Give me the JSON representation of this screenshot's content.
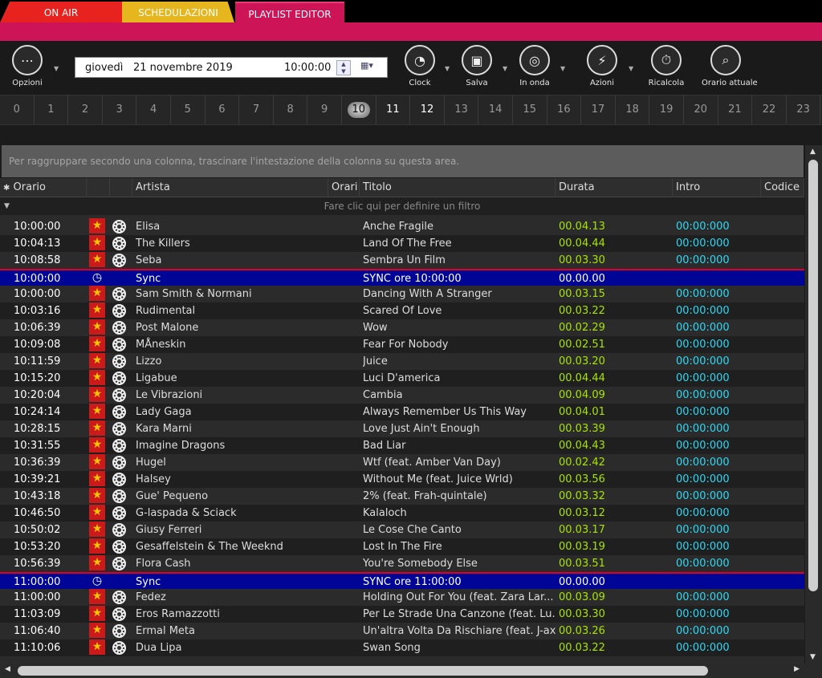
{
  "tabs": [
    {
      "label": "ON AIR"
    },
    {
      "label": "SCHEDULAZIONI"
    },
    {
      "label": "PLAYLIST EDITOR"
    }
  ],
  "toolbar": {
    "options_label": "Opzioni",
    "date": {
      "day": "giovedì",
      "date": "21 novembre 2019",
      "time": "10:00:00"
    },
    "clock_label": "Clock",
    "save_label": "Salva",
    "onair_label": "In onda",
    "actions_label": "Azioni",
    "recalc_label": "Ricalcola",
    "current_time_label": "Orario attuale"
  },
  "hours": [
    "0",
    "1",
    "2",
    "3",
    "4",
    "5",
    "6",
    "7",
    "8",
    "9",
    "10",
    "11",
    "12",
    "13",
    "14",
    "15",
    "16",
    "17",
    "18",
    "19",
    "20",
    "21",
    "22",
    "23"
  ],
  "group_panel_text": "Per raggruppare secondo una colonna, trascinare l'intestazione della colonna su questa area.",
  "columns": {
    "orario": "Orario",
    "artista": "Artista",
    "orari": "Orari",
    "titolo": "Titolo",
    "durata": "Durata",
    "intro": "Intro",
    "codice": "Codice"
  },
  "filter_text": "Fare clic qui per definire un filtro",
  "rows": [
    {
      "time": "10:00:00",
      "artist": "Elisa",
      "title": "Anche Fragile",
      "dur": "00.04.13",
      "intro": "00:00:000"
    },
    {
      "time": "10:04:13",
      "artist": "The Killers",
      "title": "Land Of The Free",
      "dur": "00.04.44",
      "intro": "00:00:000"
    },
    {
      "time": "10:08:58",
      "artist": "Seba",
      "title": "Sembra Un Film",
      "dur": "00.03.30",
      "intro": "00:00:000"
    },
    {
      "time": "10:00:00",
      "artist": "Sync",
      "title": "SYNC ore 10:00:00",
      "dur": "00.00.00",
      "intro": "",
      "sync": true
    },
    {
      "time": "10:00:00",
      "artist": "Sam Smith & Normani",
      "title": "Dancing With A Stranger",
      "dur": "00.03.15",
      "intro": "00:00:000"
    },
    {
      "time": "10:03:16",
      "artist": "Rudimental",
      "title": "Scared Of Love",
      "dur": "00.03.22",
      "intro": "00:00:000"
    },
    {
      "time": "10:06:39",
      "artist": "Post Malone",
      "title": "Wow",
      "dur": "00.02.29",
      "intro": "00:00:000"
    },
    {
      "time": "10:09:08",
      "artist": "MÅneskin",
      "title": "Fear For Nobody",
      "dur": "00.02.51",
      "intro": "00:00:000"
    },
    {
      "time": "10:11:59",
      "artist": "Lizzo",
      "title": "Juice",
      "dur": "00.03.20",
      "intro": "00:00:000"
    },
    {
      "time": "10:15:20",
      "artist": "Ligabue",
      "title": "Luci D'america",
      "dur": "00.04.44",
      "intro": "00:00:000"
    },
    {
      "time": "10:20:04",
      "artist": "Le Vibrazioni",
      "title": "Cambia",
      "dur": "00.04.09",
      "intro": "00:00:000"
    },
    {
      "time": "10:24:14",
      "artist": "Lady Gaga",
      "title": "Always Remember Us This Way",
      "dur": "00.04.01",
      "intro": "00:00:000"
    },
    {
      "time": "10:28:15",
      "artist": "Kara Marni",
      "title": "Love Just Ain't Enough",
      "dur": "00.03.39",
      "intro": "00:00:000"
    },
    {
      "time": "10:31:55",
      "artist": "Imagine Dragons",
      "title": "Bad Liar",
      "dur": "00.04.43",
      "intro": "00:00:000"
    },
    {
      "time": "10:36:39",
      "artist": "Hugel",
      "title": "Wtf (feat. Amber Van Day)",
      "dur": "00.02.42",
      "intro": "00:00:000"
    },
    {
      "time": "10:39:21",
      "artist": "Halsey",
      "title": "Without Me (feat. Juice Wrld)",
      "dur": "00.03.56",
      "intro": "00:00:000"
    },
    {
      "time": "10:43:18",
      "artist": "Gue' Pequeno",
      "title": "2% (feat. Frah-quintale)",
      "dur": "00.03.32",
      "intro": "00:00:000"
    },
    {
      "time": "10:46:50",
      "artist": "G-laspada & Sciack",
      "title": "Kalaloch",
      "dur": "00.03.12",
      "intro": "00:00:000"
    },
    {
      "time": "10:50:02",
      "artist": "Giusy Ferreri",
      "title": "Le Cose Che Canto",
      "dur": "00.03.17",
      "intro": "00:00:000"
    },
    {
      "time": "10:53:20",
      "artist": "Gesaffelstein & The Weeknd",
      "title": "Lost In The Fire",
      "dur": "00.03.19",
      "intro": "00:00:000"
    },
    {
      "time": "10:56:39",
      "artist": "Flora Cash",
      "title": "You're Somebody Else",
      "dur": "00.03.51",
      "intro": "00:00:000"
    },
    {
      "time": "11:00:00",
      "artist": "Sync",
      "title": "SYNC ore 11:00:00",
      "dur": "00.00.00",
      "intro": "",
      "sync": true
    },
    {
      "time": "11:00:00",
      "artist": "Fedez",
      "title": "Holding Out For You (feat. Zara Lar...",
      "dur": "00.03.09",
      "intro": "00:00:000"
    },
    {
      "time": "11:03:09",
      "artist": "Eros Ramazzotti",
      "title": "Per Le Strade Una Canzone (feat. Lu...",
      "dur": "00.03.30",
      "intro": "00:00:000"
    },
    {
      "time": "11:06:40",
      "artist": "Ermal Meta",
      "title": "Un'altra Volta Da Rischiare (feat. J-ax)",
      "dur": "00.03.26",
      "intro": "00:00:000"
    },
    {
      "time": "11:10:06",
      "artist": "Dua Lipa",
      "title": "Swan Song",
      "dur": "00.03.22",
      "intro": "00:00:000"
    }
  ]
}
